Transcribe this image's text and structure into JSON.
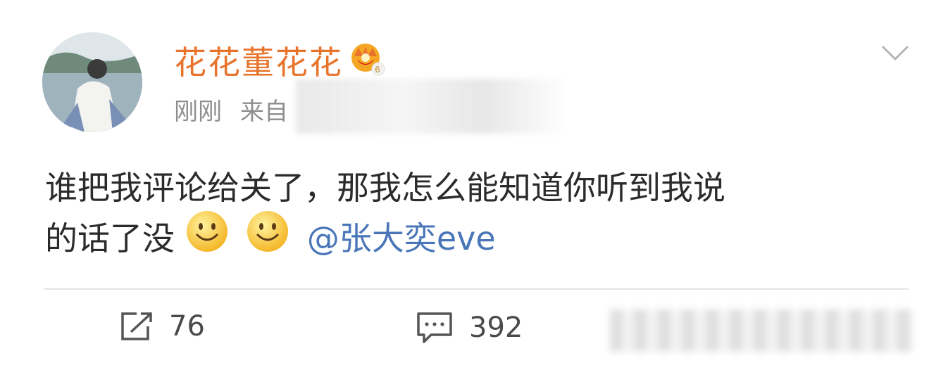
{
  "post": {
    "username": "花花董花花",
    "vip_level": "6",
    "time": "刚刚",
    "source_prefix": "来自",
    "text_line1": "谁把我评论给关了，那我怎么能知道你听到我说",
    "text_line2": "的话了没",
    "emojis": [
      "smile-emoji",
      "smile-emoji"
    ],
    "mention": "@张大奕eve"
  },
  "actions": {
    "repost_count": "76",
    "comment_count": "392"
  },
  "colors": {
    "username": "#e8742c",
    "mention": "#4a76b8",
    "meta": "#8e8e8e",
    "text": "#2b2b2b"
  }
}
